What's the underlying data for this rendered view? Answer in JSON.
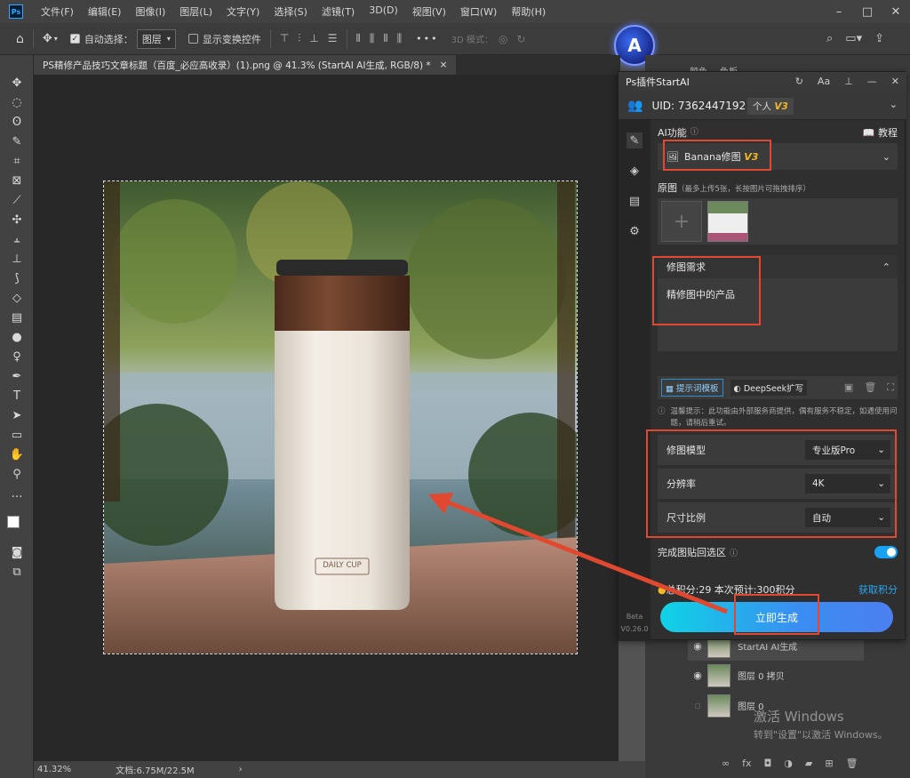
{
  "menubar": {
    "items": [
      "文件(F)",
      "编辑(E)",
      "图像(I)",
      "图层(L)",
      "文字(Y)",
      "选择(S)",
      "滤镜(T)",
      "3D(D)",
      "视图(V)",
      "窗口(W)",
      "帮助(H)"
    ]
  },
  "options": {
    "auto_select_label": "自动选择：",
    "auto_select_value": "图层",
    "show_transform_label": "显示变换控件",
    "mode3d_label": "3D 模式："
  },
  "document": {
    "tab_title": "PS精修产品技巧文章标题（百度_必应高收录）(1).png @ 41.3% (StartAI AI生成, RGB/8) *",
    "close": "×",
    "cup_text": "DAILY CUP"
  },
  "status": {
    "zoom": "41.32%",
    "doc_size": "文档:6.75M/22.5M"
  },
  "dock_tabs": [
    "颜色",
    "色板"
  ],
  "plugin": {
    "title": "Ps插件StartAI",
    "uid": "UID: 7362447192",
    "plan": "个人",
    "plan_badge": "V3",
    "ai_func_label": "AI功能",
    "tutorial_label": "教程",
    "func_name": "Banana修图",
    "func_badge": "V3",
    "source_label": "原图",
    "source_hint": "（最多上传5张，长按图片可拖拽排序）",
    "req_label": "修图需求",
    "req_text": "精修图中的产品",
    "template_btn": "提示词模板",
    "deepseek_btn": "DeepSeek扩写",
    "notice": "温馨提示：此功能由外部服务商提供，偶有服务不稳定，如遇使用问题，请稍后重试。",
    "settings": [
      {
        "label": "修图模型",
        "value": "专业版Pro"
      },
      {
        "label": "分辨率",
        "value": "4K"
      },
      {
        "label": "尺寸比例",
        "value": "自动"
      }
    ],
    "paste_back_label": "完成图贴回选区",
    "paste_back_on": true,
    "points_text": "总积分:29  本次预计:300积分",
    "get_points": "获取积分",
    "generate_btn": "立即生成",
    "version_beta": "Beta",
    "version": "V0.26.0"
  },
  "layers": [
    {
      "name": "StartAI AI生成"
    },
    {
      "name": "图层 0 拷贝"
    },
    {
      "name": "图层 0"
    }
  ],
  "watermark": {
    "line1": "激活 Windows",
    "line2": "转到\"设置\"以激活 Windows。"
  },
  "colors": {
    "accent_red": "#e0492f",
    "generate_gradient_start": "#0fd3e6",
    "generate_gradient_end": "#4b7ff0",
    "badge_gold": "#f2b825",
    "link_blue": "#2aa6f0"
  }
}
